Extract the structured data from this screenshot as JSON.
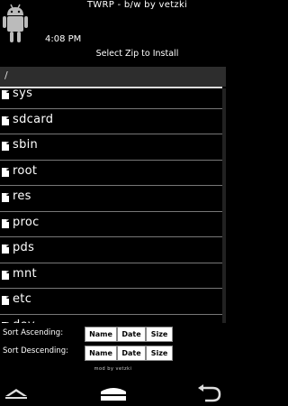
{
  "header": {
    "title": "TWRP - b/w by vetzki",
    "time": "4:08 PM",
    "prompt": "Select Zip to Install"
  },
  "path": {
    "current": "/"
  },
  "files": [
    {
      "name": "sys"
    },
    {
      "name": "sdcard"
    },
    {
      "name": "sbin"
    },
    {
      "name": "root"
    },
    {
      "name": "res"
    },
    {
      "name": "proc"
    },
    {
      "name": "pds"
    },
    {
      "name": "mnt"
    },
    {
      "name": "etc"
    },
    {
      "name": "dev"
    }
  ],
  "sort": {
    "ascending_label": "Sort Ascending:",
    "descending_label": "Sort Descending:",
    "name_label": "Name",
    "date_label": "Date",
    "size_label": "Size"
  },
  "footer": {
    "text": "mod by vetzki"
  },
  "colors": {
    "background": "#000000",
    "text": "#ffffff",
    "path_bar": "#2d2d2d",
    "separator": "#777777"
  },
  "icons": [
    "android-robot-icon",
    "file-icon",
    "back-icon",
    "home-icon",
    "recent-apps-icon"
  ]
}
